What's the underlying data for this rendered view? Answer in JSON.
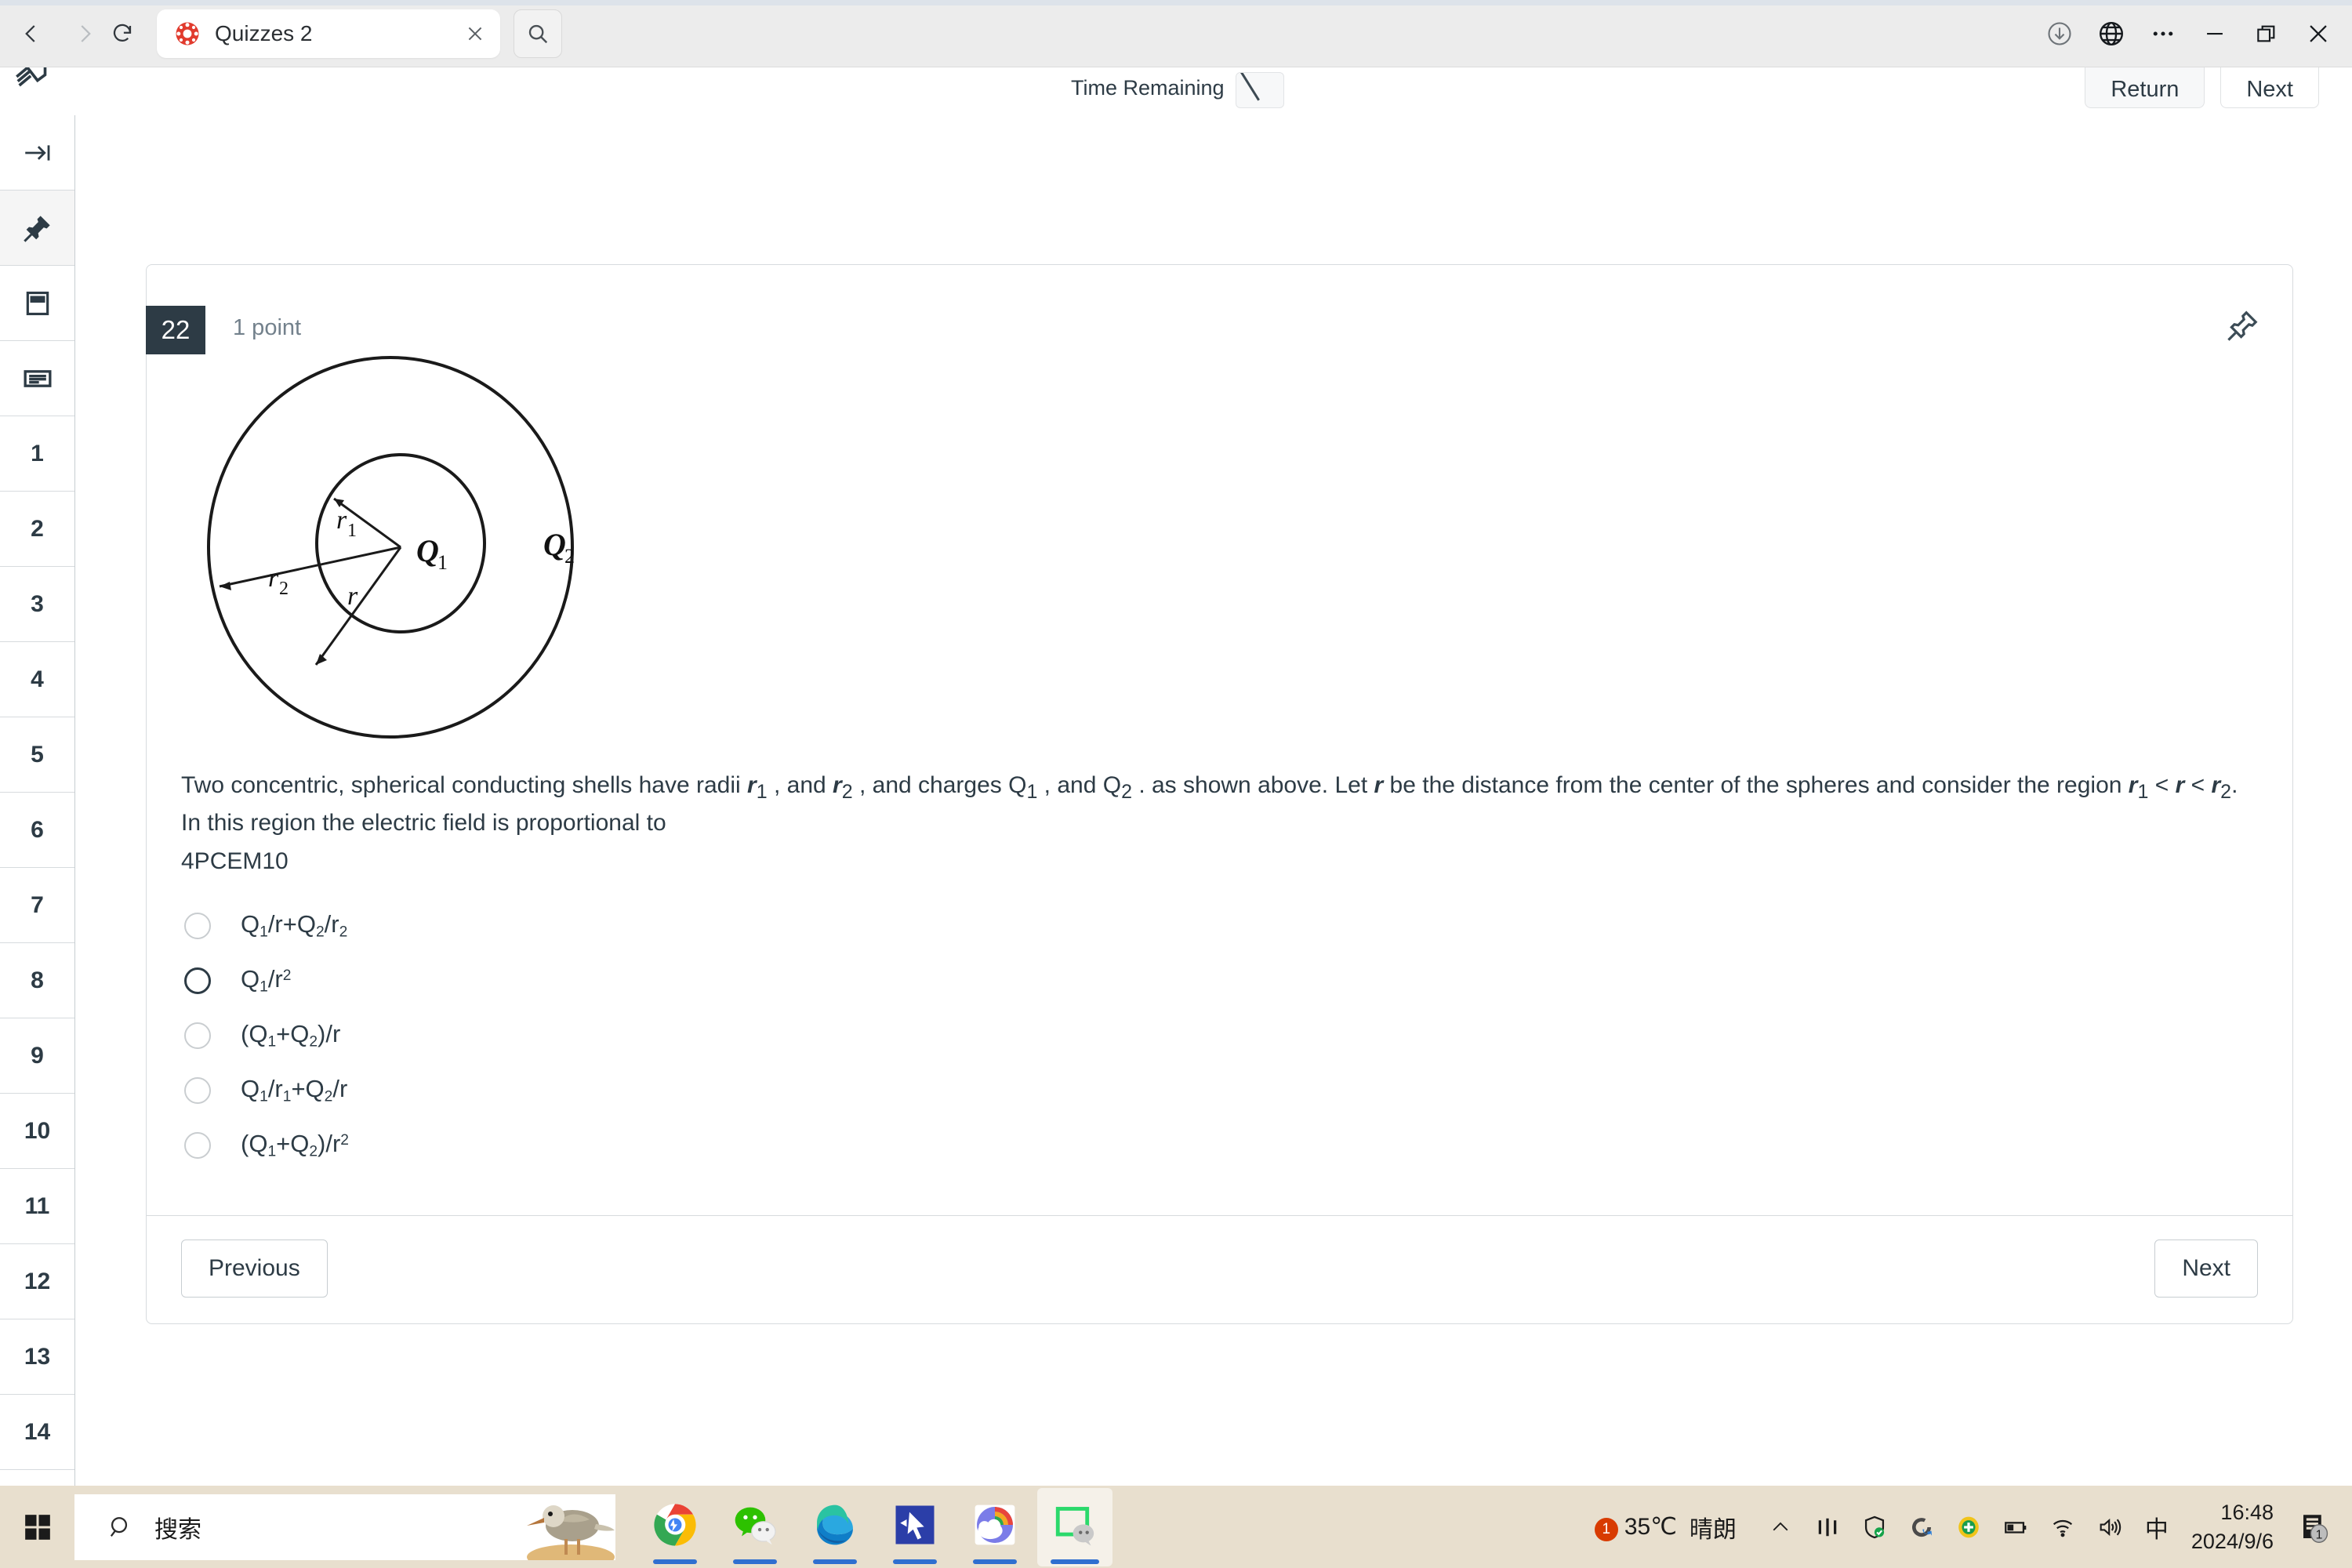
{
  "browser": {
    "back_icon": "back-arrow-icon",
    "forward_icon": "forward-arrow-icon",
    "reload_icon": "reload-icon",
    "tab": {
      "title": "Quizzes 2",
      "favicon": "canvas-lms-favicon",
      "close_icon": "close-icon"
    },
    "tab_search_icon": "search-icon",
    "window_controls": {
      "downloads_icon": "download-icon",
      "translate_icon": "globe-icon",
      "more_icon": "more-options-icon",
      "minimize_icon": "minimize-icon",
      "restore_icon": "restore-icon",
      "close_icon": "close-icon"
    }
  },
  "quiz_header": {
    "logo_icon": "quiz-logo-icon",
    "time_remaining_label": "Time Remaining",
    "timer_value": "",
    "return_label": "Return",
    "next_label": "Next"
  },
  "sidebar": {
    "tools": [
      {
        "name": "collapse-panel",
        "icon": "arrow-to-line-icon"
      },
      {
        "name": "pin-panel",
        "icon": "pin-icon",
        "active": true
      },
      {
        "name": "question-view",
        "icon": "card-icon"
      },
      {
        "name": "list-view",
        "icon": "list-icon"
      }
    ],
    "question_numbers": [
      "1",
      "2",
      "3",
      "4",
      "5",
      "6",
      "7",
      "8",
      "9",
      "10",
      "11",
      "12",
      "13",
      "14"
    ]
  },
  "question": {
    "number": "22",
    "points": "1 point",
    "flag_icon": "pin-icon",
    "figure": {
      "name": "concentric-shells-diagram",
      "labels": {
        "inner_radius": "r₁",
        "outer_radius": "r₂",
        "field_radius": "r",
        "inner_charge": "Q₁",
        "outer_charge": "Q₂"
      }
    },
    "text_line1_a": "Two concentric, spherical conducting shells have radii ",
    "text_r1": "r",
    "text_r1_sub": "1",
    "text_line1_b": " , and ",
    "text_r2": "r",
    "text_r2_sub": "2",
    "text_line1_c": " , and charges Q",
    "text_q1_sub": "1",
    "text_line1_d": " , and Q",
    "text_q2_sub": "2",
    "text_line1_e": " . as shown above. Let ",
    "text_r_var": "r",
    "text_line1_f": " be the distance from the center of the spheres and consider the region ",
    "text_line2_r1": "r",
    "text_line2_r1_sub": "1",
    "text_line2_lt1": " < ",
    "text_line2_r": "r",
    "text_line2_lt2": " < ",
    "text_line2_r2": "r",
    "text_line2_r2_sub": "2",
    "text_line2_tail": ".   In this region the electric field is proportional to",
    "code": "4PCEM10",
    "answers": [
      {
        "id": "a",
        "selected": false,
        "hovered": false,
        "parts": [
          {
            "t": "Q"
          },
          {
            "sub": "1"
          },
          {
            "t": "/r+Q"
          },
          {
            "sub": "2"
          },
          {
            "t": "/r"
          },
          {
            "sub": "2"
          }
        ]
      },
      {
        "id": "b",
        "selected": false,
        "hovered": true,
        "parts": [
          {
            "t": "Q"
          },
          {
            "sub": "1"
          },
          {
            "t": "/r"
          },
          {
            "sup": "2"
          }
        ]
      },
      {
        "id": "c",
        "selected": false,
        "hovered": false,
        "parts": [
          {
            "t": "(Q"
          },
          {
            "sub": "1"
          },
          {
            "t": "+Q"
          },
          {
            "sub": "2"
          },
          {
            "t": ")/r"
          }
        ]
      },
      {
        "id": "d",
        "selected": false,
        "hovered": false,
        "parts": [
          {
            "t": "Q"
          },
          {
            "sub": "1"
          },
          {
            "t": "/r"
          },
          {
            "sub": "1"
          },
          {
            "t": "+Q"
          },
          {
            "sub": "2"
          },
          {
            "t": "/r"
          }
        ]
      },
      {
        "id": "e",
        "selected": false,
        "hovered": false,
        "parts": [
          {
            "t": "(Q"
          },
          {
            "sub": "1"
          },
          {
            "t": "+Q"
          },
          {
            "sub": "2"
          },
          {
            "t": ")/r"
          },
          {
            "sup": "2"
          }
        ]
      }
    ],
    "previous_label": "Previous",
    "next_label": "Next"
  },
  "taskbar": {
    "start_icon": "windows-start-icon",
    "search_placeholder": "搜索",
    "search_icon": "search-icon",
    "search_thumbnail": "sandpiper-bird-image",
    "apps": [
      {
        "name": "taskbar-app-chrome",
        "icon": "chrome-icon",
        "running": true
      },
      {
        "name": "taskbar-app-wechat",
        "icon": "wechat-icon",
        "running": true
      },
      {
        "name": "taskbar-app-edge",
        "icon": "edge-icon",
        "running": true
      },
      {
        "name": "taskbar-app-cursor",
        "icon": "cursor-icon",
        "running": true
      },
      {
        "name": "taskbar-app-cloudmusic",
        "icon": "cloud-rainbow-icon",
        "running": true
      },
      {
        "name": "taskbar-app-wechat-devtools",
        "icon": "green-window-icon",
        "running": true,
        "active": true
      }
    ],
    "tray": {
      "weather_badge": "1",
      "weather_temp": "35℃",
      "weather_desc": "晴朗",
      "overflow_icon": "chevron-up-icon",
      "icons": [
        {
          "name": "tray-icon-meeting",
          "icon": "bars-icon"
        },
        {
          "name": "tray-icon-defender",
          "icon": "shield-check-icon"
        },
        {
          "name": "tray-icon-sync",
          "icon": "sync-icon"
        },
        {
          "name": "tray-icon-security",
          "icon": "green-plus-icon"
        },
        {
          "name": "tray-icon-battery",
          "icon": "battery-icon"
        },
        {
          "name": "tray-icon-network",
          "icon": "wifi-icon"
        },
        {
          "name": "tray-icon-volume",
          "icon": "speaker-icon"
        },
        {
          "name": "tray-icon-ime",
          "icon": "ime-chinese-icon",
          "label": "中"
        }
      ],
      "clock_time": "16:48",
      "clock_date": "2024/9/6",
      "notification_count": "1",
      "notification_icon": "notification-icon"
    }
  },
  "colors": {
    "canvas_dark": "#2d3b45",
    "muted_text": "#73818c",
    "border": "#d7dbde",
    "chrome_bg": "#ececec",
    "taskbar_bg": "#e8dfce",
    "accent_blue": "#2f6fd0",
    "canvas_red": "#e13b2e"
  }
}
